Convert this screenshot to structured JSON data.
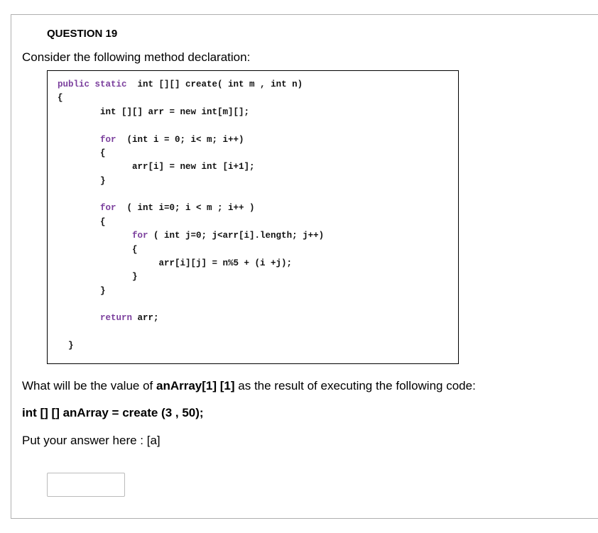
{
  "header": "QUESTION 19",
  "intro": "Consider the following method declaration:",
  "code": {
    "l1a": "public static",
    "l1b": "  int [][] create( int m , int n)",
    "l2": "{",
    "l3": "        int [][] arr = new int[m][];",
    "l4": "",
    "l5a": "        for",
    "l5b": "  (int i = 0; i< m; i++)",
    "l6": "        {",
    "l7": "              arr[i] = new int [i+1];",
    "l8": "        }",
    "l9": "",
    "l10a": "        for",
    "l10b": "  ( int i=0; i < m ; i++ )",
    "l11": "        {",
    "l12a": "              for",
    "l12b": " ( int j=0; j<arr[i].length; j++)",
    "l13": "              {",
    "l14": "                   arr[i][j] = n%5 + (i +j);",
    "l15": "              }",
    "l16": "        }",
    "l17": "",
    "l18a": "        return",
    "l18b": " arr;",
    "l19": "",
    "l20": "  }"
  },
  "followup": {
    "line1a": "What will be the value of ",
    "line1b": "anArray[1] [1]",
    "line1c": " as the result of executing the following code:",
    "line2a": "int [] [] anArray = ",
    "line2b": " create (3 , 50);",
    "line3": "Put your answer here : [a]"
  },
  "answer_value": ""
}
